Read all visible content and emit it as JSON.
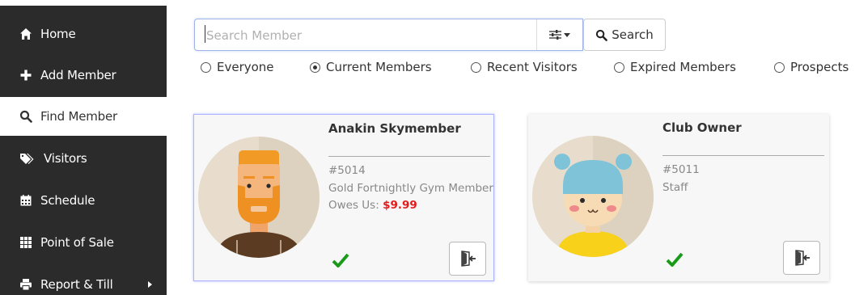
{
  "sidebar": {
    "items": [
      {
        "label": "Home",
        "icon": "home-icon"
      },
      {
        "label": "Add Member",
        "icon": "plus-icon"
      },
      {
        "label": "Find Member",
        "icon": "search-icon"
      },
      {
        "label": "Visitors",
        "icon": "tags-icon"
      },
      {
        "label": "Schedule",
        "icon": "calendar-icon"
      },
      {
        "label": "Point of Sale",
        "icon": "grid-icon"
      },
      {
        "label": "Report & Till",
        "icon": "printer-icon"
      }
    ],
    "active_index": 2
  },
  "search": {
    "placeholder": "Search Member",
    "value": "",
    "filter_icon": "sliders-icon",
    "button_label": "Search"
  },
  "filters": [
    {
      "label": "Everyone",
      "selected": false
    },
    {
      "label": "Current Members",
      "selected": true
    },
    {
      "label": "Recent Visitors",
      "selected": false
    },
    {
      "label": "Expired Members",
      "selected": false
    },
    {
      "label": "Prospects",
      "selected": false
    }
  ],
  "members": [
    {
      "name": "Anakin Skymember",
      "id": "#5014",
      "membership": "Gold Fortnightly Gym Member",
      "owes_label": "Owes Us:",
      "owes_amount": "$9.99",
      "status": "check-icon",
      "selected": true
    },
    {
      "name": "Club Owner",
      "id": "#5011",
      "membership": "Staff",
      "status": "check-icon",
      "selected": false
    }
  ],
  "colors": {
    "sidebar_bg": "#2b2b2b",
    "accent_border": "#a9b3ff",
    "owes_red": "#e21b1b",
    "check_green": "#1a9a1a"
  }
}
